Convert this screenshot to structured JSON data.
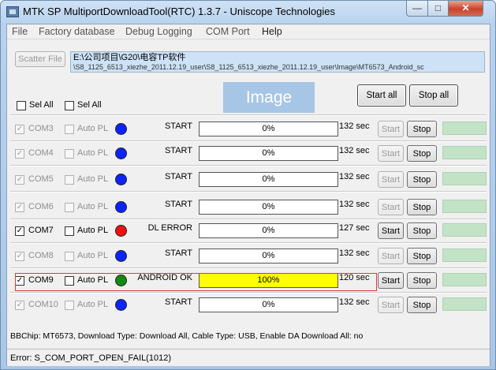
{
  "window": {
    "title": "MTK SP MultiportDownloadTool(RTC) 1.3.7 - Uniscope Technologies"
  },
  "window_buttons": {
    "minimize": "—",
    "maximize": "□",
    "close": "✕"
  },
  "menu": [
    "File",
    "Factory database",
    "Debug Logging",
    "COM Port",
    "Help"
  ],
  "scatter": {
    "button_label": "Scatter File",
    "path_line1": "E:\\公司项目\\G20\\电容TP软件",
    "path_line2": "\\S8_1125_6513_xiezhe_2011.12.19_user\\S8_1125_6513_xiezhe_2011.12.19_user\\Image\\MT6573_Android_sc"
  },
  "logo_text": "Image",
  "select_all": [
    {
      "label": "Sel All"
    },
    {
      "label": "Sel All"
    }
  ],
  "global_buttons": {
    "start_all": "Start all",
    "stop_all": "Stop all"
  },
  "ports": [
    {
      "com": "COM3",
      "checked": true,
      "enabled": false,
      "auto_label": "Auto PL",
      "auto_checked": false,
      "dot_color": "#0b24ff",
      "status": "START",
      "progress": 0,
      "progress_text": "0%",
      "time": "132 sec",
      "start": "Start",
      "stop": "Stop",
      "start_enabled": false
    },
    {
      "com": "COM4",
      "checked": true,
      "enabled": false,
      "auto_label": "Auto PL",
      "auto_checked": false,
      "dot_color": "#0b24ff",
      "status": "START",
      "progress": 0,
      "progress_text": "0%",
      "time": "132 sec",
      "start": "Start",
      "stop": "Stop",
      "start_enabled": false
    },
    {
      "com": "COM5",
      "checked": true,
      "enabled": false,
      "auto_label": "Auto PL",
      "auto_checked": false,
      "dot_color": "#0b24ff",
      "status": "START",
      "progress": 0,
      "progress_text": "0%",
      "time": "132 sec",
      "start": "Start",
      "stop": "Stop",
      "start_enabled": false
    },
    {
      "com": "COM6",
      "checked": true,
      "enabled": false,
      "auto_label": "Auto PL",
      "auto_checked": false,
      "dot_color": "#0b24ff",
      "status": "START",
      "progress": 0,
      "progress_text": "0%",
      "time": "132 sec",
      "start": "Start",
      "stop": "Stop",
      "start_enabled": false
    },
    {
      "com": "COM7",
      "checked": true,
      "enabled": true,
      "auto_label": "Auto PL",
      "auto_checked": false,
      "dot_color": "#ee1111",
      "status": "DL ERROR",
      "progress": 0,
      "progress_text": "0%",
      "time": "127 sec",
      "start": "Start",
      "stop": "Stop",
      "start_enabled": true
    },
    {
      "com": "COM8",
      "checked": true,
      "enabled": false,
      "auto_label": "Auto PL",
      "auto_checked": false,
      "dot_color": "#0b24ff",
      "status": "START",
      "progress": 0,
      "progress_text": "0%",
      "time": "132 sec",
      "start": "Start",
      "stop": "Stop",
      "start_enabled": false
    },
    {
      "com": "COM9",
      "checked": true,
      "enabled": true,
      "auto_label": "Auto PL",
      "auto_checked": false,
      "dot_color": "#128a12",
      "status": "ANDROID OK",
      "progress": 100,
      "progress_text": "100%",
      "time": "120 sec",
      "start": "Start",
      "stop": "Stop",
      "start_enabled": true
    },
    {
      "com": "COM10",
      "checked": true,
      "enabled": false,
      "auto_label": "Auto PL",
      "auto_checked": false,
      "dot_color": "#0b24ff",
      "status": "START",
      "progress": 0,
      "progress_text": "0%",
      "time": "132 sec",
      "start": "Start",
      "stop": "Stop",
      "start_enabled": false
    }
  ],
  "info_line": "BBChip: MT6573,  Download Type: Download All,  Cable Type: USB,  Enable DA Download All: no",
  "error_line": "Error: S_COM_PORT_OPEN_FAIL(1012)",
  "colors": {
    "progress_fill": "#ffff00",
    "ready_box": "#c3e3c6"
  }
}
